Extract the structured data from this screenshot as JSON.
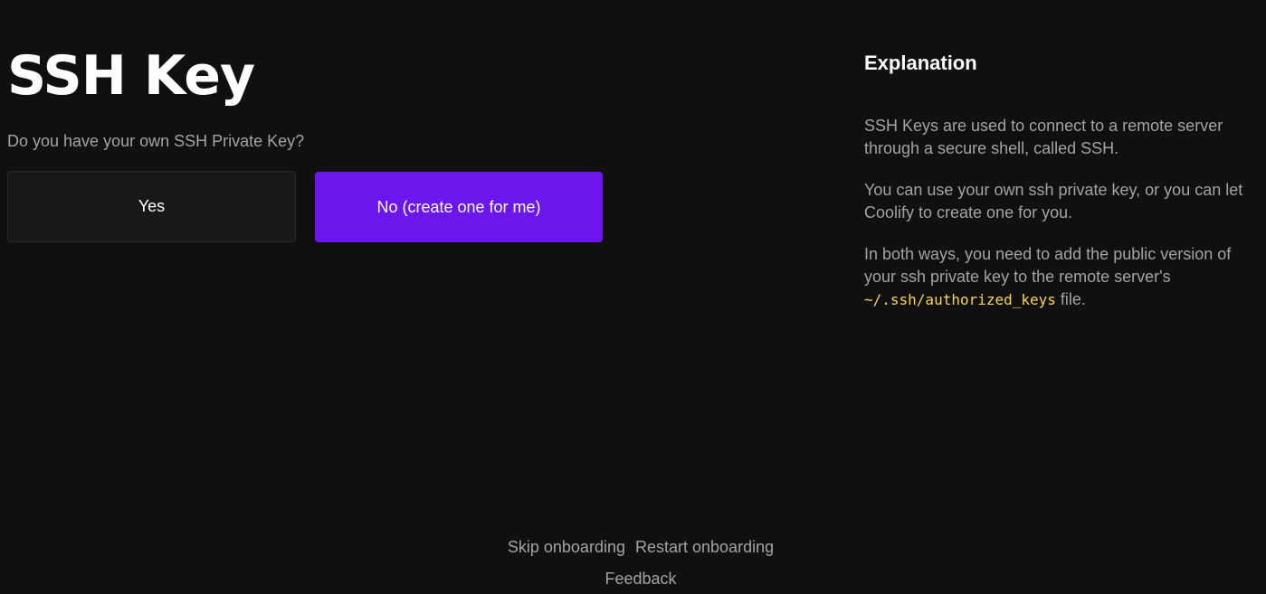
{
  "main": {
    "title": "SSH Key",
    "question": "Do you have your own SSH Private Key?",
    "yes_label": "Yes",
    "no_label": "No (create one for me)"
  },
  "explanation": {
    "title": "Explanation",
    "p1": "SSH Keys are used to connect to a remote server through a secure shell, called SSH.",
    "p2": "You can use your own ssh private key, or you can let Coolify to create one for you.",
    "p3_before": "In both ways, you need to add the public version of your ssh private key to the remote server's ",
    "p3_code": "~/.ssh/authorized_keys",
    "p3_after": " file."
  },
  "footer": {
    "skip": "Skip onboarding",
    "restart": "Restart onboarding",
    "feedback": "Feedback"
  },
  "colors": {
    "background": "#101010",
    "accent": "#6b16ed",
    "code": "#fcd452"
  }
}
